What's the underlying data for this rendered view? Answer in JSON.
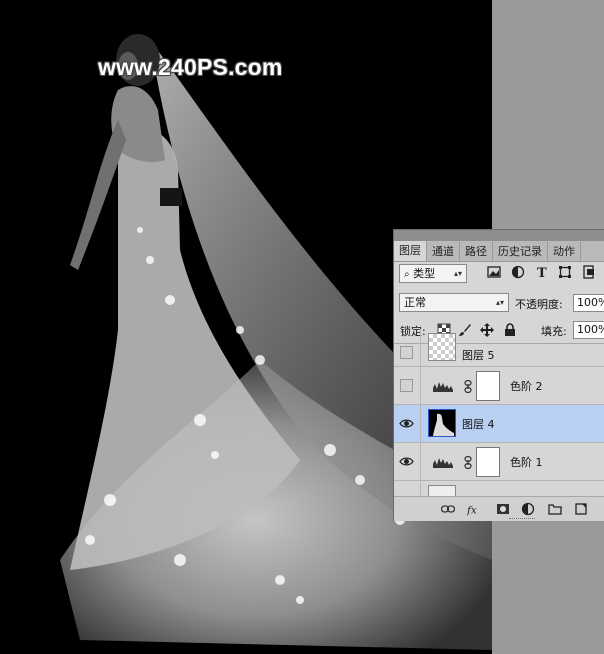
{
  "watermark": {
    "text": "www.240PS.com"
  },
  "layers_panel": {
    "tabs": [
      {
        "label": "图层",
        "active": true
      },
      {
        "label": "通道",
        "active": false
      },
      {
        "label": "路径",
        "active": false
      },
      {
        "label": "历史记录",
        "active": false
      },
      {
        "label": "动作",
        "active": false
      }
    ],
    "filter": {
      "icon": "search-icon",
      "value": "类型"
    },
    "blend_mode": {
      "value": "正常"
    },
    "opacity": {
      "label": "不透明度:",
      "value": "100%"
    },
    "lock": {
      "label": "锁定:"
    },
    "fill": {
      "label": "填充:",
      "value": "100%"
    },
    "layers": [
      {
        "name": "图层 5",
        "type": "pixel",
        "visible": false,
        "selected": false
      },
      {
        "name": "色阶 2",
        "type": "levels-adjustment",
        "visible": false,
        "selected": false
      },
      {
        "name": "图层 4",
        "type": "pixel",
        "visible": true,
        "selected": true
      },
      {
        "name": "色阶 1",
        "type": "levels-adjustment",
        "visible": true,
        "selected": false
      }
    ]
  },
  "colors": {
    "canvas_bg": "#000000",
    "panel_bg": "#d6d6d6",
    "selected_layer": "#b9d0f2",
    "workspace_bg": "#9a9a9a"
  }
}
